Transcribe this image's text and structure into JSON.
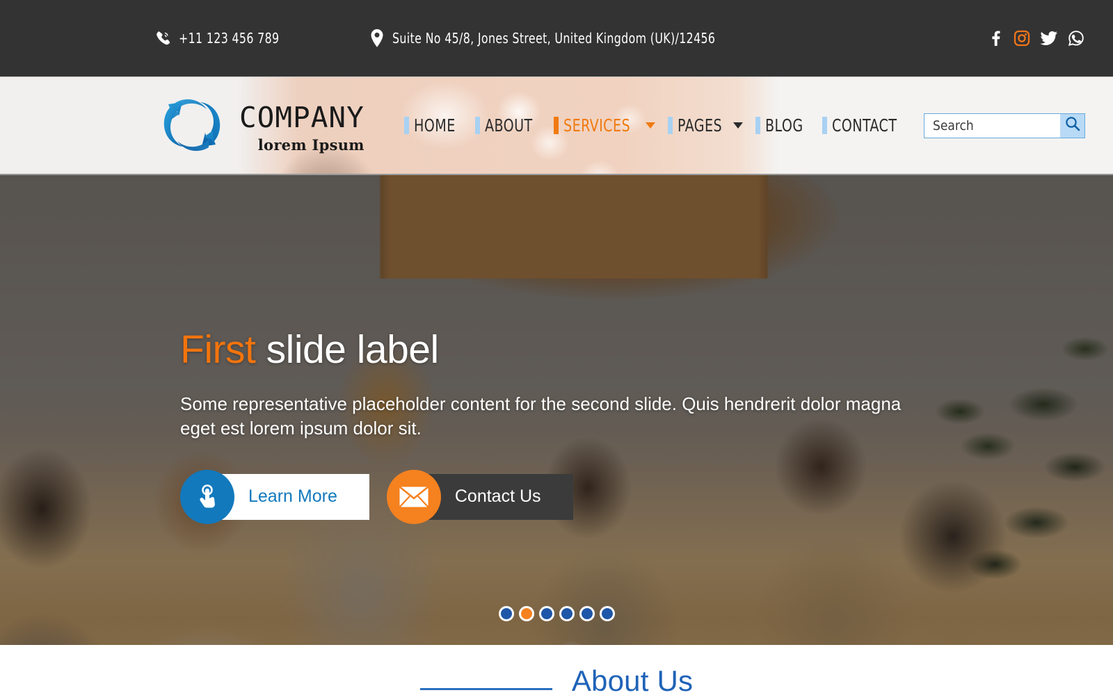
{
  "topbar": {
    "phone_icon": "phone-ringing-icon",
    "phone": "+11 123 456 789",
    "location_icon": "map-pin-icon",
    "address": "Suite No 45/8, Jones Street, United Kingdom  (UK)/12456",
    "socials": [
      {
        "name": "facebook-icon",
        "label": "Facebook"
      },
      {
        "name": "instagram-icon",
        "label": "Instagram"
      },
      {
        "name": "twitter-icon",
        "label": "Twitter"
      },
      {
        "name": "whatsapp-icon",
        "label": "WhatsApp"
      }
    ]
  },
  "header": {
    "logo": {
      "icon": "circular-arrows-logo-icon",
      "name": "COMPANY",
      "tagline": "lorem Ipsum"
    },
    "nav": [
      {
        "label": "HOME",
        "active": false,
        "dropdown": false
      },
      {
        "label": "ABOUT",
        "active": false,
        "dropdown": false
      },
      {
        "label": "SERVICES",
        "active": true,
        "dropdown": true
      },
      {
        "label": "PAGES",
        "active": false,
        "dropdown": true
      },
      {
        "label": "BLOG",
        "active": false,
        "dropdown": false
      },
      {
        "label": "CONTACT",
        "active": false,
        "dropdown": false
      }
    ],
    "search": {
      "placeholder": "Search",
      "value": "",
      "button_icon": "search-icon"
    }
  },
  "hero": {
    "title_highlight": "First",
    "title_rest": " slide label",
    "description": "Some representative placeholder content for the second slide. Quis hendrerit dolor magna eget est lorem ipsum dolor sit.",
    "buttons": [
      {
        "label": "Learn More",
        "icon": "hand-pointer-icon"
      },
      {
        "label": "Contact Us",
        "icon": "envelope-icon"
      }
    ],
    "carousel": {
      "total": 6,
      "active_index": 1
    }
  },
  "about": {
    "title": "About Us"
  },
  "colors": {
    "topbar_bg": "#333333",
    "accent_orange": "#f07a10",
    "accent_blue": "#1279bd",
    "nav_bar_blue": "#a8d1f2",
    "search_btn_bg": "#b9daf6",
    "about_blue": "#1f63b8",
    "dot_blue": "#1e56a8"
  }
}
